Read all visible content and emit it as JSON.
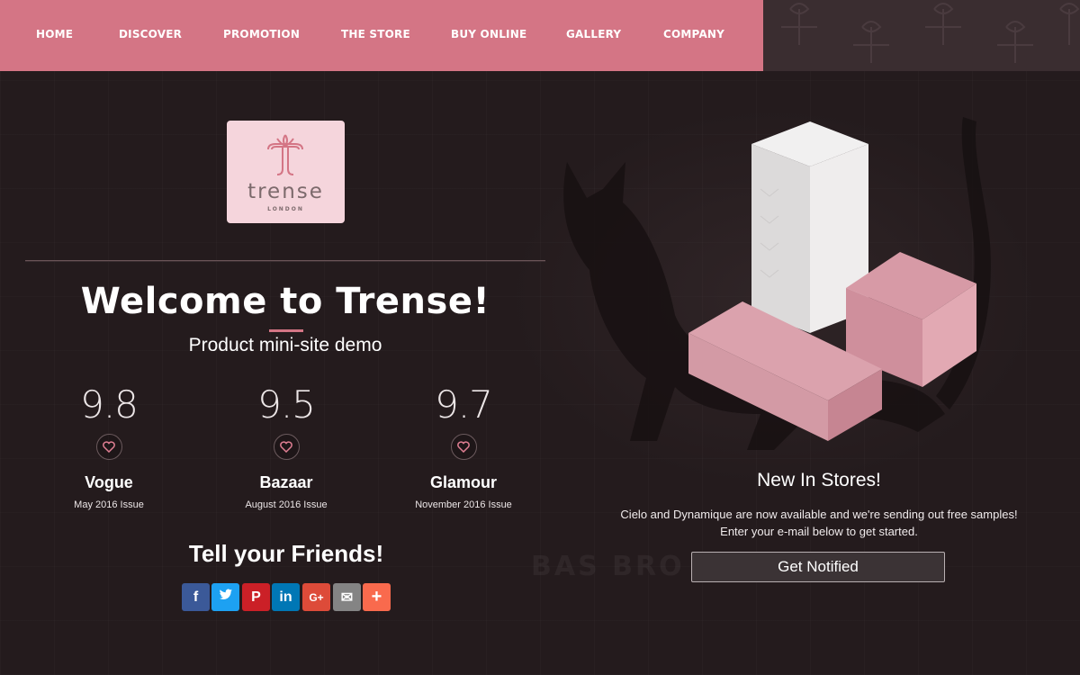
{
  "nav": {
    "items": [
      {
        "label": "HOME"
      },
      {
        "label": "DISCOVER"
      },
      {
        "label": "PROMOTION"
      },
      {
        "label": "THE STORE"
      },
      {
        "label": "BUY ONLINE"
      },
      {
        "label": "GALLERY"
      },
      {
        "label": "COMPANY"
      }
    ]
  },
  "logo": {
    "name": "trense",
    "sub": "LONDON"
  },
  "hero": {
    "title": "Welcome to Trense!",
    "subtitle": "Product mini-site demo"
  },
  "ratings": [
    {
      "score": "9.8",
      "name": "Vogue",
      "issue": "May 2016 Issue"
    },
    {
      "score": "9.5",
      "name": "Bazaar",
      "issue": "August 2016 Issue"
    },
    {
      "score": "9.7",
      "name": "Glamour",
      "issue": "November 2016 Issue"
    }
  ],
  "share": {
    "title": "Tell your Friends!",
    "buttons": [
      {
        "icon": "facebook-icon",
        "glyph": "f",
        "color": "#3b5998"
      },
      {
        "icon": "twitter-icon",
        "glyph": "t",
        "color": "#1da1f2"
      },
      {
        "icon": "pinterest-icon",
        "glyph": "P",
        "color": "#cb2027"
      },
      {
        "icon": "linkedin-icon",
        "glyph": "in",
        "color": "#0077b5"
      },
      {
        "icon": "google-plus-icon",
        "glyph": "G+",
        "color": "#dd4b39"
      },
      {
        "icon": "email-icon",
        "glyph": "✉",
        "color": "#848484"
      },
      {
        "icon": "more-icon",
        "glyph": "+",
        "color": "#f96a4d"
      }
    ]
  },
  "promo": {
    "title": "New In Stores!",
    "line1": "Cielo and Dynamique are now available and we're sending out free samples!",
    "line2": "Enter your e-mail below to get started.",
    "button": "Get Notified"
  },
  "colors": {
    "accent": "#d47585",
    "background": "#231a1c"
  }
}
